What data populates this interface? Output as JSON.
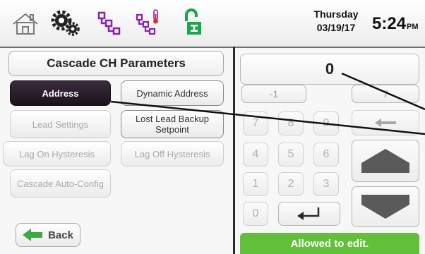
{
  "header": {
    "day": "Thursday",
    "date": "03/19/17",
    "time": "5:24",
    "ampm": "PM",
    "icons": [
      "home-icon",
      "gear-icon",
      "cascade-icon",
      "temperature-icon",
      "unlock-icon"
    ],
    "colors": {
      "purple": "#8a1fb0",
      "green": "#1aa64a",
      "red": "#d93030",
      "gray": "#7a7a7a"
    }
  },
  "left": {
    "title": "Cascade CH Parameters",
    "buttons": [
      {
        "label": "Address",
        "state": "selected"
      },
      {
        "label": "Dynamic Address",
        "state": "active"
      },
      {
        "label": "Lead Settings",
        "state": "dim"
      },
      {
        "label": "Lost Lead Backup Setpoint",
        "state": "active"
      },
      {
        "label": "Lag On Hysteresis",
        "state": "dim"
      },
      {
        "label": "Lag Off Hysteresis",
        "state": "dim"
      },
      {
        "label": "Cascade Auto-Config",
        "state": "dim"
      }
    ],
    "back_label": "Back"
  },
  "keypad": {
    "display_value": "0",
    "min_label": "-1",
    "max_label": "7",
    "keys": [
      "7",
      "8",
      "9",
      "4",
      "5",
      "6",
      "1",
      "2",
      "3",
      "0"
    ],
    "status": "Allowed to edit.",
    "status_color": "#62bf3a"
  }
}
